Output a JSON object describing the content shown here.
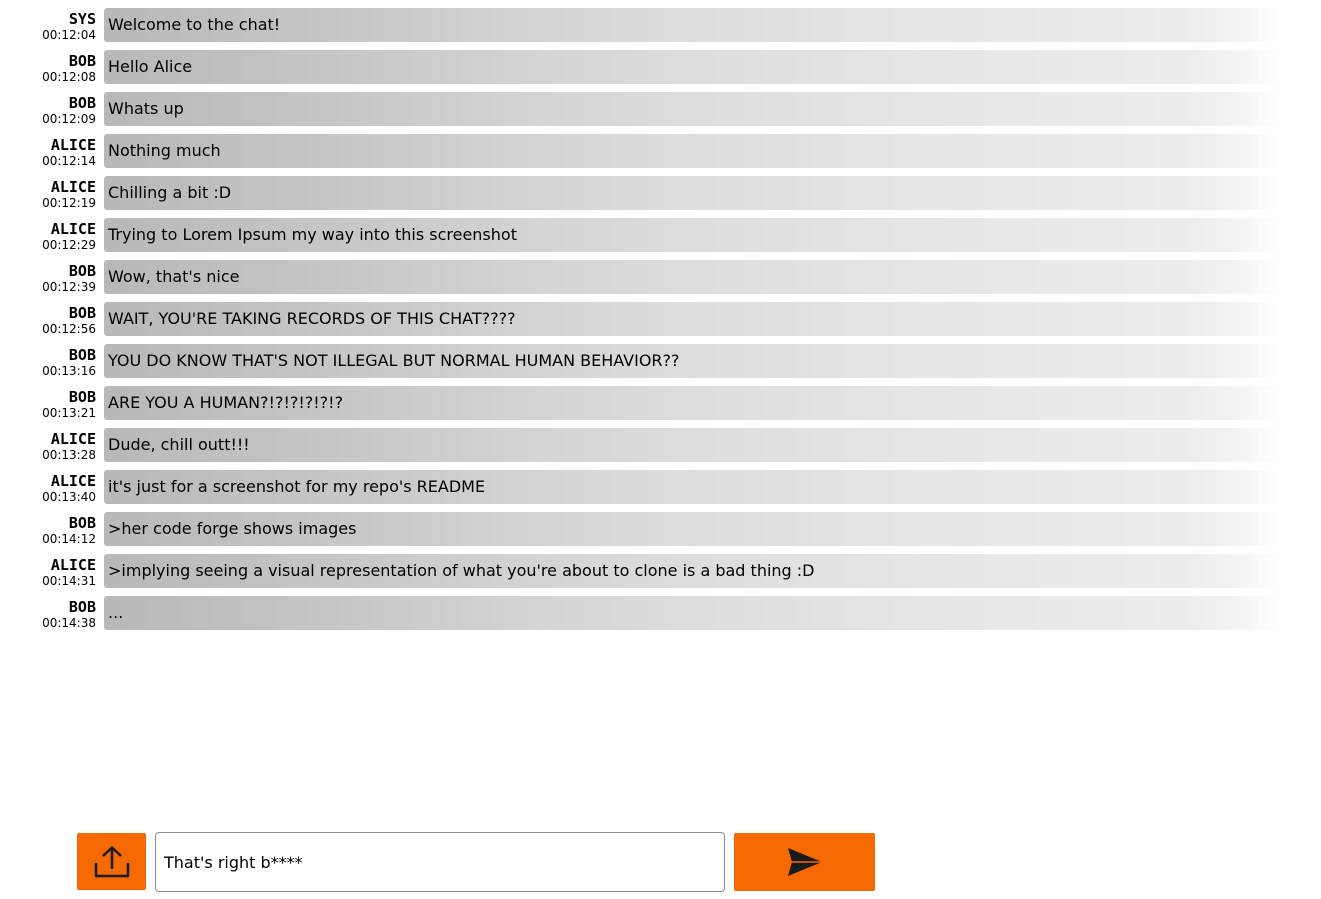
{
  "messages": [
    {
      "sender": "SYS",
      "time": "00:12:04",
      "text": "Welcome to the chat!"
    },
    {
      "sender": "BOB",
      "time": "00:12:08",
      "text": "Hello Alice"
    },
    {
      "sender": "BOB",
      "time": "00:12:09",
      "text": "Whats up"
    },
    {
      "sender": "ALICE",
      "time": "00:12:14",
      "text": "Nothing much"
    },
    {
      "sender": "ALICE",
      "time": "00:12:19",
      "text": "Chilling a bit :D"
    },
    {
      "sender": "ALICE",
      "time": "00:12:29",
      "text": "Trying to Lorem Ipsum my way into this screenshot"
    },
    {
      "sender": "BOB",
      "time": "00:12:39",
      "text": "Wow, that's nice"
    },
    {
      "sender": "BOB",
      "time": "00:12:56",
      "text": "WAIT, YOU'RE TAKING RECORDS OF THIS CHAT????"
    },
    {
      "sender": "BOB",
      "time": "00:13:16",
      "text": "YOU DO KNOW THAT'S NOT ILLEGAL BUT NORMAL HUMAN BEHAVIOR??"
    },
    {
      "sender": "BOB",
      "time": "00:13:21",
      "text": "ARE YOU A HUMAN?!?!?!?!?!?"
    },
    {
      "sender": "ALICE",
      "time": "00:13:28",
      "text": "Dude, chill outt!!!"
    },
    {
      "sender": "ALICE",
      "time": "00:13:40",
      "text": "it's just for a screenshot for my repo's README"
    },
    {
      "sender": "BOB",
      "time": "00:14:12",
      "text": ">her code forge shows images"
    },
    {
      "sender": "ALICE",
      "time": "00:14:31",
      "text": ">implying seeing a visual representation of what you're about to clone is a bad thing :D"
    },
    {
      "sender": "BOB",
      "time": "00:14:38",
      "text": "..."
    }
  ],
  "composer": {
    "input_value": "That's right b****",
    "upload_icon": "upload-icon",
    "send_icon": "send-icon",
    "accent_color": "#f56a00"
  }
}
